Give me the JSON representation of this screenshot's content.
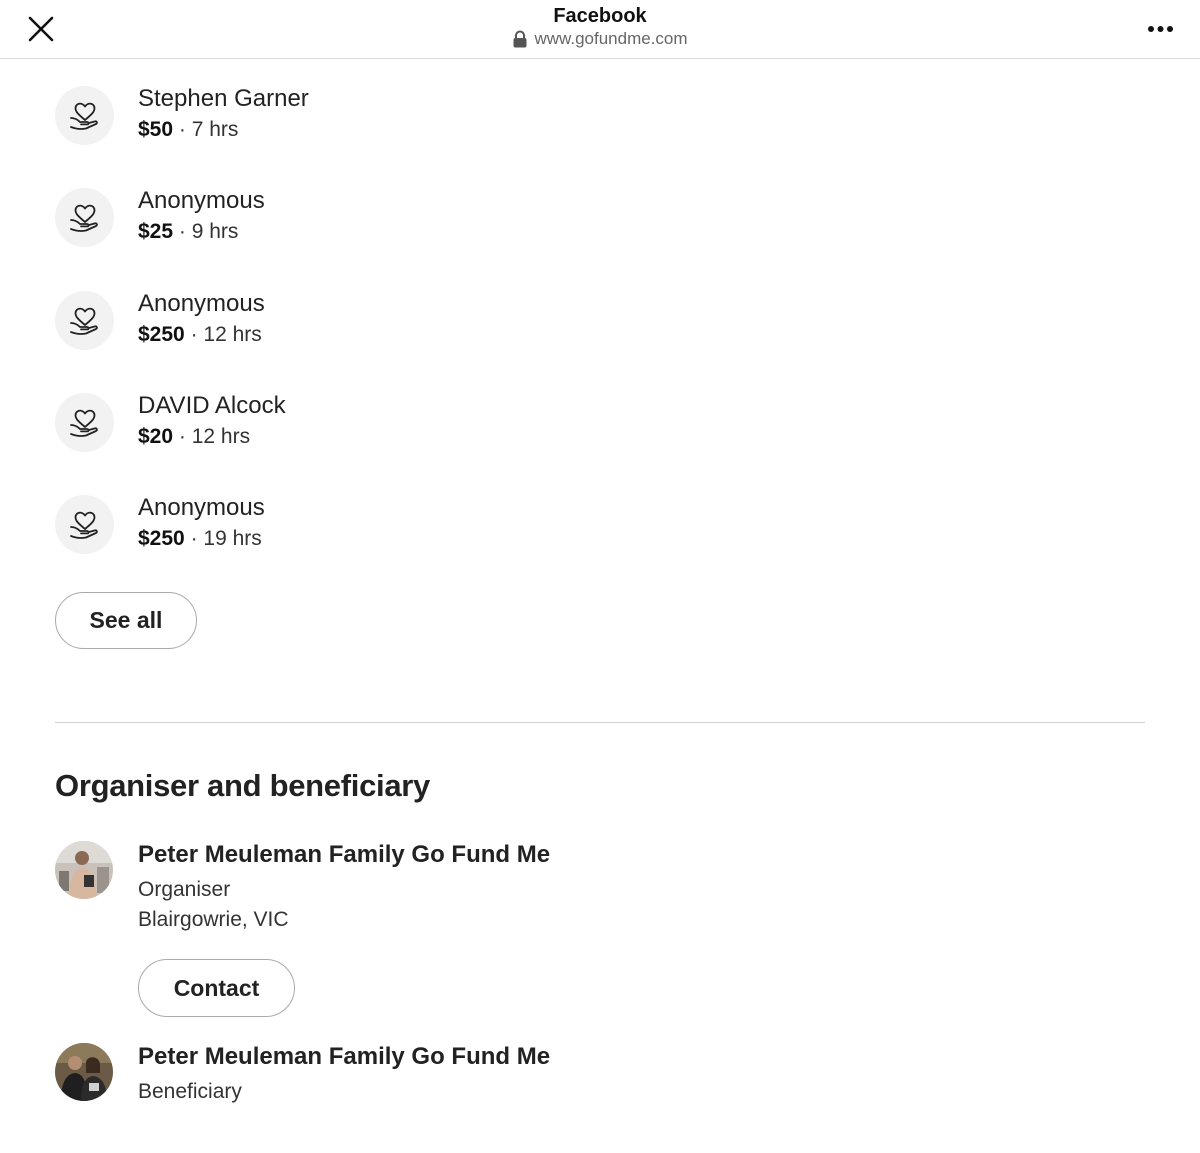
{
  "browser": {
    "title": "Facebook",
    "url": "www.gofundme.com",
    "close_icon": "close-icon",
    "lock_icon": "lock-icon",
    "more_icon": "more-icon"
  },
  "donations": [
    {
      "name": "Stephen Garner",
      "amount": "$50",
      "time": "7 hrs"
    },
    {
      "name": "Anonymous",
      "amount": "$25",
      "time": "9 hrs"
    },
    {
      "name": "Anonymous",
      "amount": "$250",
      "time": "12 hrs"
    },
    {
      "name": "DAVID Alcock",
      "amount": "$20",
      "time": "12 hrs"
    },
    {
      "name": "Anonymous",
      "amount": "$250",
      "time": "19 hrs"
    }
  ],
  "separator": "·",
  "see_all_label": "See all",
  "organiser_section": {
    "title": "Organiser and beneficiary",
    "organiser": {
      "name": "Peter Meuleman Family Go Fund Me",
      "role": "Organiser",
      "location": "Blairgowrie, VIC",
      "contact_label": "Contact"
    },
    "beneficiary": {
      "name": "Peter Meuleman Family Go Fund Me",
      "role": "Beneficiary"
    }
  }
}
